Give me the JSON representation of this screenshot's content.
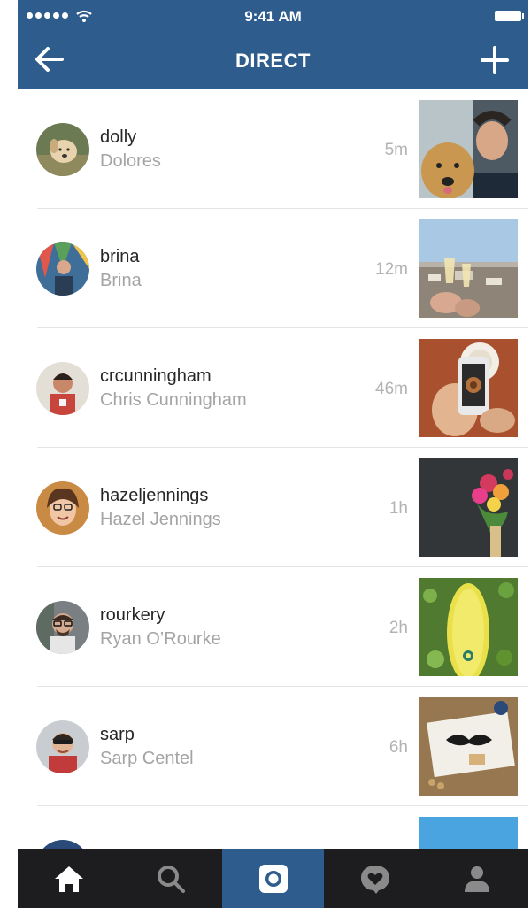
{
  "status_bar": {
    "time": "9:41 AM"
  },
  "header": {
    "title": "DIRECT",
    "back_icon": "back-arrow-icon",
    "new_icon": "plus-icon"
  },
  "conversations": [
    {
      "username": "dolly",
      "name": "Dolores",
      "time": "5m"
    },
    {
      "username": "brina",
      "name": "Brina",
      "time": "12m"
    },
    {
      "username": "crcunningham",
      "name": "Chris Cunningham",
      "time": "46m"
    },
    {
      "username": "hazeljennings",
      "name": "Hazel Jennings",
      "time": "1h"
    },
    {
      "username": "rourkery",
      "name": "Ryan O’Rourke",
      "time": "2h"
    },
    {
      "username": "sarp",
      "name": "Sarp Centel",
      "time": "6h"
    }
  ],
  "tab_bar": {
    "tabs": [
      "home-icon",
      "search-icon",
      "camera-icon",
      "activity-icon",
      "profile-icon"
    ],
    "active": "camera-icon"
  },
  "colors": {
    "header": "#2e5c8c",
    "tab_bar": "#1d1d1f",
    "active_tab": "#2e5c8c"
  }
}
